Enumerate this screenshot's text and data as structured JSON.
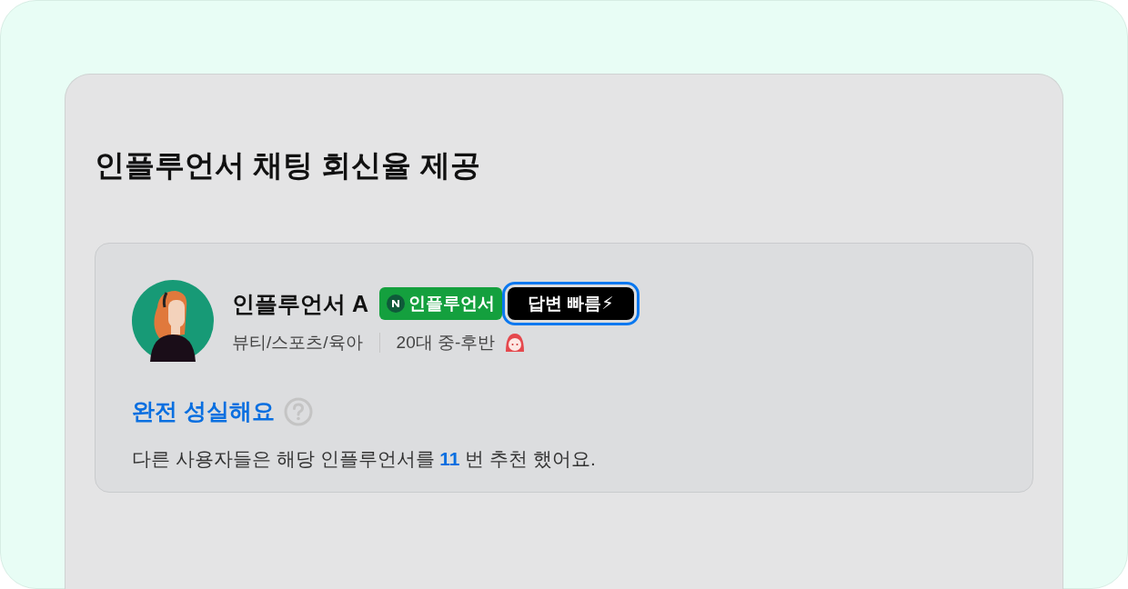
{
  "section_title": "인플루언서 채팅 회신율 제공",
  "profile": {
    "name": "인플루언서 A",
    "badges": [
      {
        "kind": "verified",
        "label": "인플루언서",
        "highlighted": false
      },
      {
        "kind": "speed",
        "label": "답변 빠름⚡",
        "highlighted": true
      }
    ],
    "categories": "뷰티/스포츠/육아",
    "age": "20대 중-후반"
  },
  "rating": {
    "label": "완전 성실해요"
  },
  "recommendation": "다른 사용자들은 해당 인플루언서를 **11** 번 추천 했어요."
}
